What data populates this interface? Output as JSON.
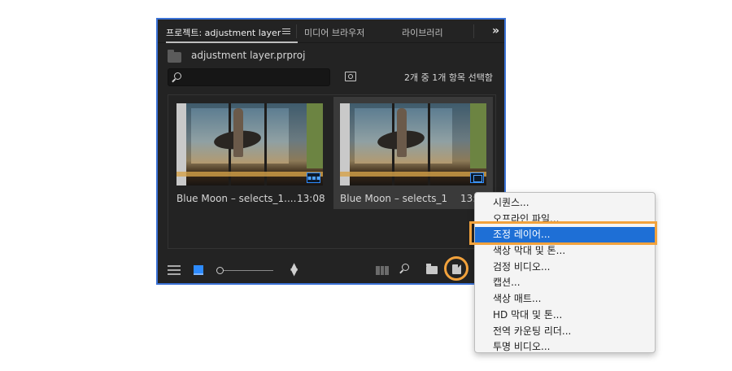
{
  "panel": {
    "tabs": [
      {
        "label": "프로젝트: adjustment layer",
        "active": true
      },
      {
        "label": "미디어 브라우저",
        "active": false
      },
      {
        "label": "라이브러리",
        "active": false
      }
    ],
    "project_file": "adjustment layer.prproj",
    "search": {
      "value": "",
      "placeholder": ""
    },
    "selection_count": "2개 중 1개 항목 선택함",
    "items": [
      {
        "title": "Blue Moon – selects_1....",
        "duration": "13:08",
        "selected": false,
        "badge": "sequence"
      },
      {
        "title": "Blue Moon – selects_1",
        "duration": "13:",
        "selected": true,
        "badge": "adjustment"
      }
    ]
  },
  "context_menu": {
    "items": [
      {
        "label": "시퀀스..."
      },
      {
        "label": "오프라인 파일..."
      },
      {
        "label": "조정 레이어...",
        "highlighted": true
      },
      {
        "label": "색상 막대 및 톤..."
      },
      {
        "label": "검정 비디오..."
      },
      {
        "label": "캡션..."
      },
      {
        "label": "색상 매트..."
      },
      {
        "label": "HD 막대 및 톤..."
      },
      {
        "label": "전역 카운팅 리더..."
      },
      {
        "label": "투명 비디오..."
      }
    ]
  },
  "colors": {
    "panel_border": "#3b72d6",
    "panel_bg": "#232323",
    "accent_blue": "#2d8bff",
    "highlight_orange": "#f2a23c",
    "menu_selected": "#1e6fd6"
  }
}
